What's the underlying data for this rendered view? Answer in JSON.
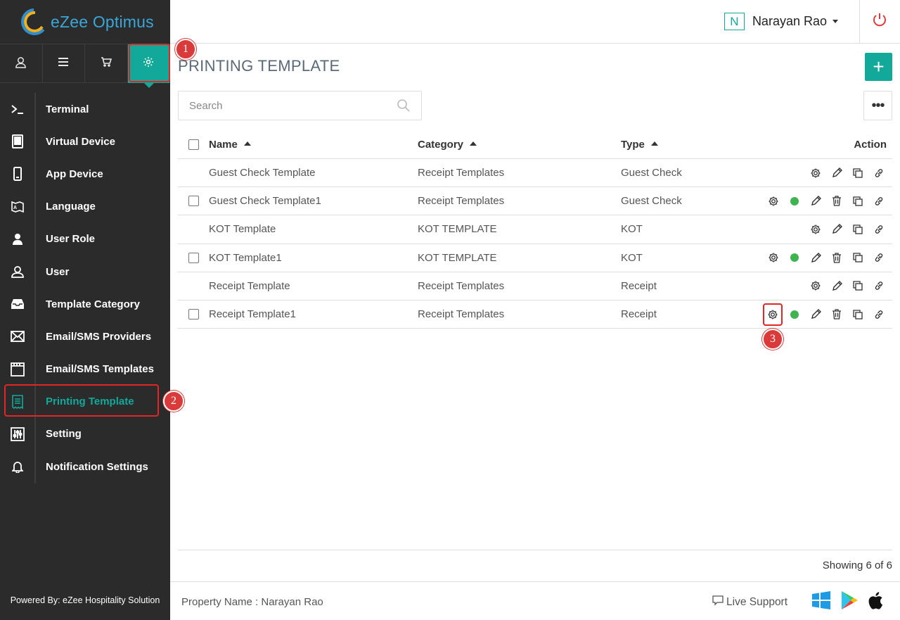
{
  "app": {
    "brand": "eZee Optimus"
  },
  "header": {
    "user_initial": "N",
    "user_name": "Narayan Rao"
  },
  "topnav": [
    "user-nav-icon",
    "menu-nav-icon",
    "cart-nav-icon",
    "settings-nav-icon"
  ],
  "sidebar": {
    "items": [
      {
        "label": "Terminal",
        "icon": "terminal-icon"
      },
      {
        "label": "Virtual Device",
        "icon": "tablet-icon"
      },
      {
        "label": "App Device",
        "icon": "mobile-icon"
      },
      {
        "label": "Language",
        "icon": "language-icon"
      },
      {
        "label": "User Role",
        "icon": "user-role-icon"
      },
      {
        "label": "User",
        "icon": "user-icon"
      },
      {
        "label": "Template Category",
        "icon": "inbox-icon"
      },
      {
        "label": "Email/SMS Providers",
        "icon": "envelope-icon"
      },
      {
        "label": "Email/SMS Templates",
        "icon": "template-icon"
      },
      {
        "label": "Printing Template",
        "icon": "receipt-icon",
        "active": true
      },
      {
        "label": "Setting",
        "icon": "sliders-icon"
      },
      {
        "label": "Notification Settings",
        "icon": "bell-icon"
      }
    ],
    "powered_by": "Powered By: eZee Hospitality Solution"
  },
  "main": {
    "title": "PRINTING TEMPLATE",
    "add_label": "+",
    "search_placeholder": "Search",
    "more_label": "•••",
    "columns": {
      "name": "Name",
      "category": "Category",
      "type": "Type",
      "action": "Action"
    },
    "rows": [
      {
        "name": "Guest Check Template",
        "category": "Receipt Templates",
        "type": "Guest Check",
        "custom": false
      },
      {
        "name": "Guest Check Template1",
        "category": "Receipt Templates",
        "type": "Guest Check",
        "custom": true
      },
      {
        "name": "KOT Template",
        "category": "KOT TEMPLATE",
        "type": "KOT",
        "custom": false
      },
      {
        "name": "KOT Template1",
        "category": "KOT TEMPLATE",
        "type": "KOT",
        "custom": true
      },
      {
        "name": "Receipt Template",
        "category": "Receipt Templates",
        "type": "Receipt",
        "custom": false
      },
      {
        "name": "Receipt Template1",
        "category": "Receipt Templates",
        "type": "Receipt",
        "custom": true
      }
    ],
    "showing": "Showing 6 of 6"
  },
  "footer": {
    "property": "Property Name : Narayan Rao",
    "live_support": "Live Support"
  },
  "annotations": [
    "1",
    "2",
    "3"
  ],
  "colors": {
    "accent": "#12a99b",
    "sidebar_bg": "#2b2b2b",
    "callout": "#d93b3b",
    "status_active": "#3fb34f",
    "brand": "#3aa7d8"
  }
}
